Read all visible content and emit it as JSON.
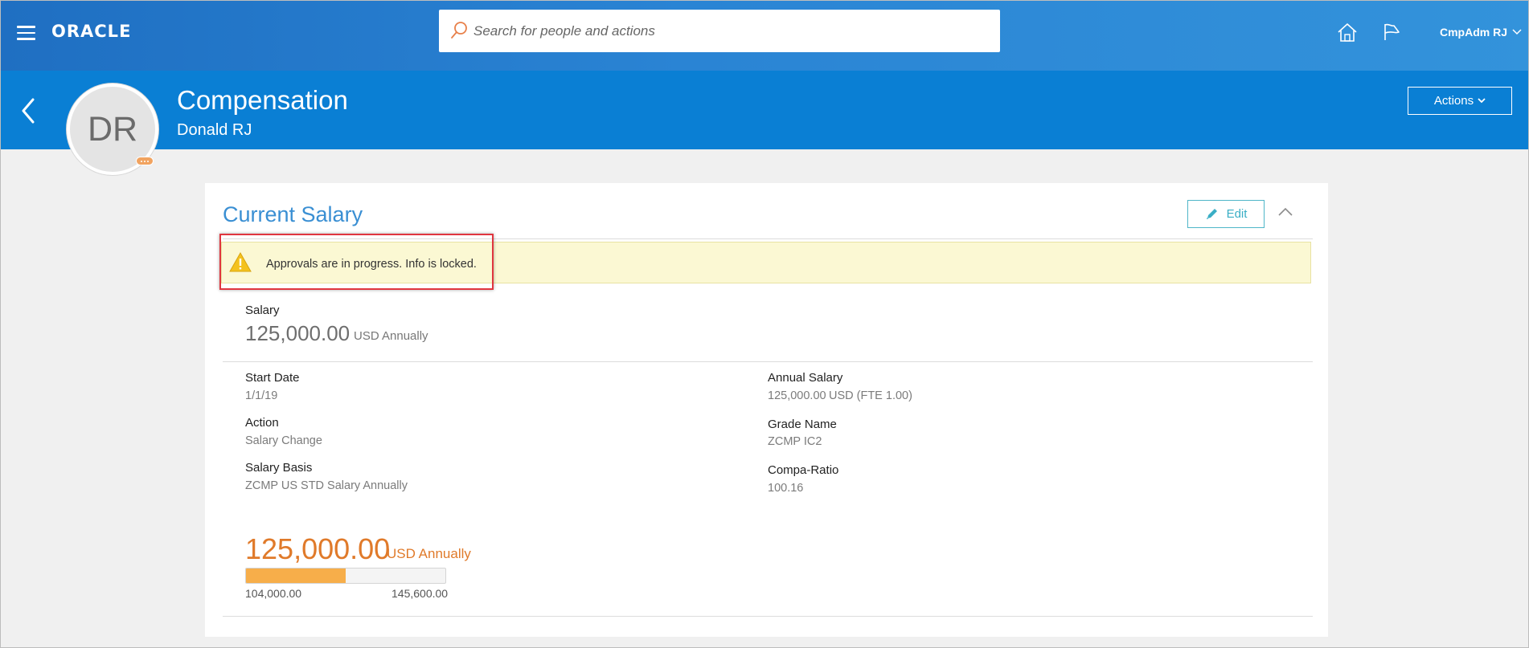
{
  "topbar": {
    "menu_icon": "hamburger-icon",
    "logo": "ORACLE",
    "search_placeholder": "Search for people and actions",
    "search_icon": "search-icon",
    "home_icon": "home-icon",
    "navigator_icon": "navigator-flag-icon",
    "user_name": "CmpAdm RJ"
  },
  "header": {
    "title": "Compensation",
    "subtitle": "Donald RJ",
    "avatar_initials": "DR",
    "actions_label": "Actions",
    "back_icon": "chevron-left-icon"
  },
  "card": {
    "title": "Current Salary",
    "edit_label": "Edit",
    "edit_icon": "pencil-icon",
    "collapse_icon": "chevron-up-icon",
    "banner": {
      "icon": "warning-icon",
      "message": "Approvals are in progress. Info is locked."
    },
    "salary": {
      "label": "Salary",
      "amount": "125,000.00",
      "currency": "USD",
      "frequency": "Annually"
    },
    "left_fields": [
      {
        "label": "Start Date",
        "value": "1/1/19"
      },
      {
        "label": "Action",
        "value": "Salary Change"
      },
      {
        "label": "Salary Basis",
        "value": "ZCMP US STD Salary Annually"
      }
    ],
    "right_fields": [
      {
        "label": "Annual Salary",
        "value": "125,000.00",
        "value_extra": "USD (FTE 1.00)"
      },
      {
        "label": "Grade Name",
        "value": "ZCMP IC2"
      },
      {
        "label": "Compa-Ratio",
        "value": "100.16"
      }
    ],
    "range": {
      "amount": "125,000.00",
      "unit": "USD Annually",
      "min": "104,000.00",
      "max": "145,600.00",
      "fill_fraction": 0.5
    }
  },
  "colors": {
    "topbar": "#2a84d4",
    "header": "#0a7fd4",
    "accent_title": "#3a8fd3",
    "range_orange": "#e07a2a",
    "range_fill": "#f7ae4a",
    "highlight": "#e0363f"
  }
}
